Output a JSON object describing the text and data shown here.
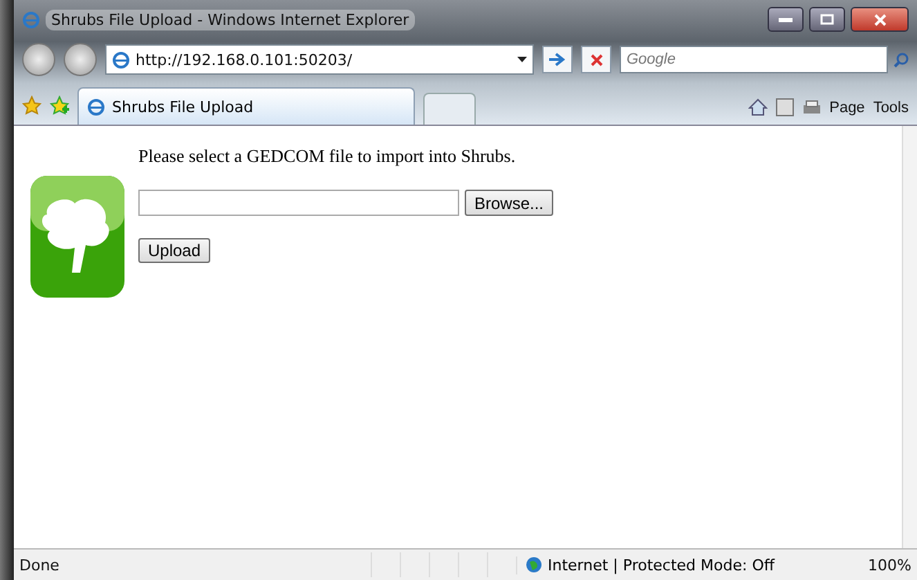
{
  "window": {
    "title": "Shrubs File Upload - Windows Internet Explorer"
  },
  "address_bar": {
    "value": "http://192.168.0.101:50203/"
  },
  "search": {
    "placeholder": "Google"
  },
  "tabs": [
    {
      "label": "Shrubs File Upload",
      "selected": true
    }
  ],
  "command_bar": [
    "Page",
    "Tools"
  ],
  "page": {
    "prompt": "Please select a GEDCOM file to import into Shrubs.",
    "browse_button": "Browse...",
    "upload_button": "Upload"
  },
  "status_bar": {
    "text": "Done",
    "zone": "Internet | Protected Mode: Off",
    "zoom": "100%"
  }
}
